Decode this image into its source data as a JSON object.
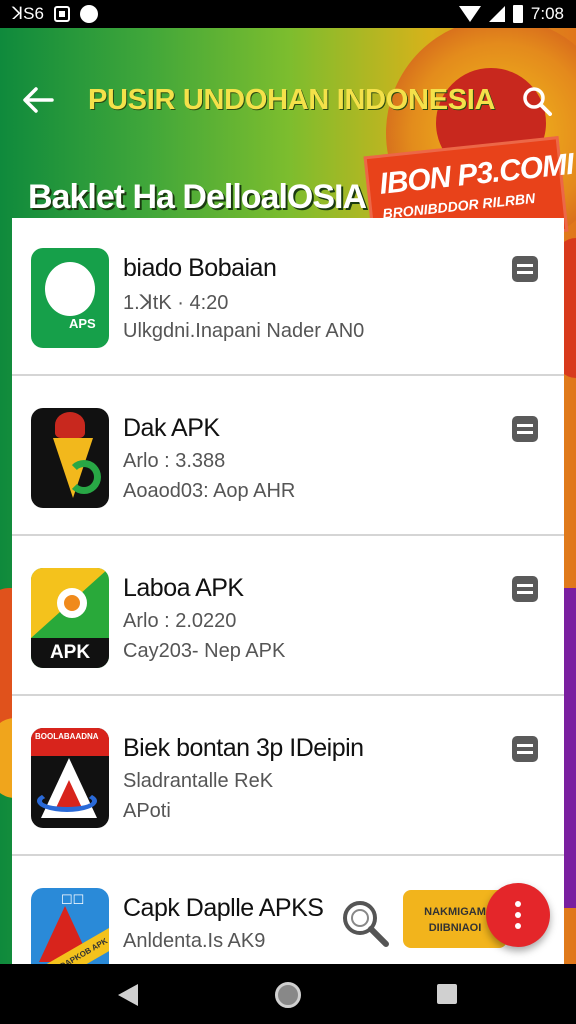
{
  "status_bar": {
    "left_text": "ꓘS6",
    "time": "7:08"
  },
  "header": {
    "title": "PUSIR UNDOHAN INDONESIA"
  },
  "banner": {
    "subtitle": "Baklet Ha DelloalOSIA",
    "promo_line1": "IBON P3.COMI",
    "promo_line2": "BRONIBDDOR RILRBN"
  },
  "apps": [
    {
      "name": "biado Bobaian",
      "meta": "1.ꓘtK · 4:20",
      "sub": "Ulkgdni.Inapani Nader AN0",
      "icon": "app-icon-green-chat"
    },
    {
      "name": "Dak APK",
      "meta": "Arlo : 3.388",
      "sub": "Aoaod03: Aop AHR",
      "icon": "app-icon-garuda"
    },
    {
      "name": "Laboa APK",
      "meta": "Arlo : 2.0220",
      "sub": "Cay203- Nep APK",
      "icon": "app-icon-apk"
    },
    {
      "name": "Biek bontan 3p IDeipin",
      "meta": "Sladrantalle ReK",
      "sub": "APoti",
      "icon": "app-icon-red-triangle"
    },
    {
      "name": "Capk Daplle APKS",
      "meta": "Anldenta.Is AK9",
      "sub": "",
      "icon": "app-icon-blue-triangle"
    }
  ],
  "app_icon_labels": {
    "first": "APS",
    "third": "APK",
    "fourth_top": "BOOLABAADNA",
    "fifth_band": "DAPKOB APK"
  },
  "floating_badge": {
    "line1": "NAKMIGAM",
    "line2": "DIIBNIAOI"
  },
  "colors": {
    "accent": "#e4262a",
    "title_yellow": "#f4e14a",
    "banner_green": "#0f8a3c"
  }
}
